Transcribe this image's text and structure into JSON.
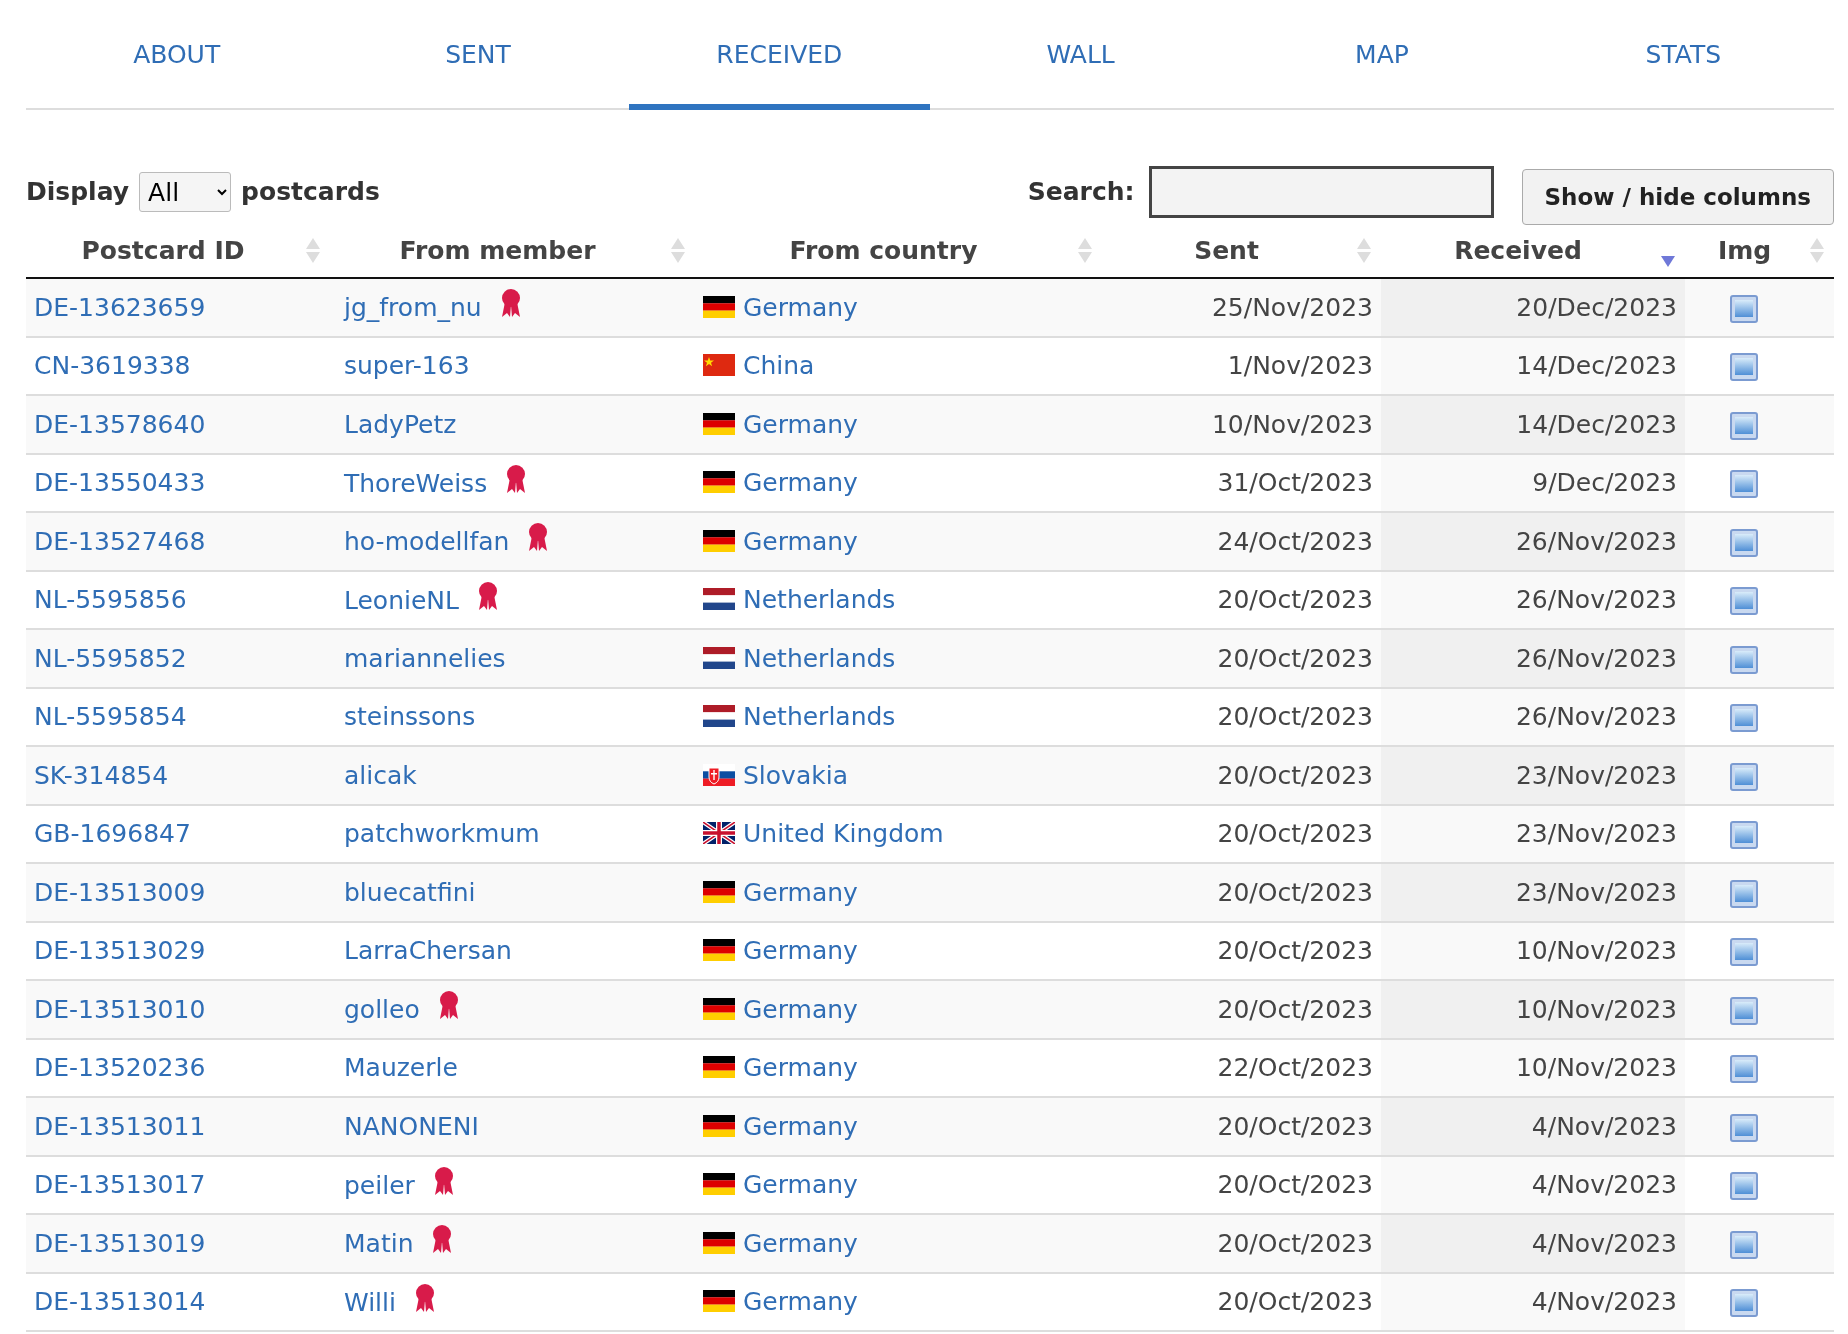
{
  "tabs": [
    {
      "label": "ABOUT",
      "selected": false
    },
    {
      "label": "SENT",
      "selected": false
    },
    {
      "label": "RECEIVED",
      "selected": true
    },
    {
      "label": "WALL",
      "selected": false
    },
    {
      "label": "MAP",
      "selected": false
    },
    {
      "label": "STATS",
      "selected": false
    }
  ],
  "display": {
    "label": "Display",
    "value": "All",
    "suffix": "postcards"
  },
  "search": {
    "label": "Search:"
  },
  "columns_button": "Show / hide columns",
  "columns": [
    {
      "label": "Postcard ID",
      "sorted": false
    },
    {
      "label": "From member",
      "sorted": false
    },
    {
      "label": "From country",
      "sorted": false
    },
    {
      "label": "Sent",
      "sorted": false
    },
    {
      "label": "Received",
      "sorted": true
    },
    {
      "label": "Img",
      "sorted": false
    }
  ],
  "rows": [
    {
      "id": "DE-13623659",
      "member": "jg_from_nu",
      "award": true,
      "kind": "de",
      "country": "Germany",
      "sent": "25/Nov/2023",
      "received": "20/Dec/2023"
    },
    {
      "id": "CN-3619338",
      "member": "super-163",
      "award": false,
      "kind": "cn",
      "country": "China",
      "sent": "1/Nov/2023",
      "received": "14/Dec/2023"
    },
    {
      "id": "DE-13578640",
      "member": "LadyPetz",
      "award": false,
      "kind": "de",
      "country": "Germany",
      "sent": "10/Nov/2023",
      "received": "14/Dec/2023"
    },
    {
      "id": "DE-13550433",
      "member": "ThoreWeiss",
      "award": true,
      "kind": "de",
      "country": "Germany",
      "sent": "31/Oct/2023",
      "received": "9/Dec/2023"
    },
    {
      "id": "DE-13527468",
      "member": "ho-modellfan",
      "award": true,
      "kind": "de",
      "country": "Germany",
      "sent": "24/Oct/2023",
      "received": "26/Nov/2023"
    },
    {
      "id": "NL-5595856",
      "member": "LeonieNL",
      "award": true,
      "kind": "nl",
      "country": "Netherlands",
      "sent": "20/Oct/2023",
      "received": "26/Nov/2023"
    },
    {
      "id": "NL-5595852",
      "member": "mariannelies",
      "award": false,
      "kind": "nl",
      "country": "Netherlands",
      "sent": "20/Oct/2023",
      "received": "26/Nov/2023"
    },
    {
      "id": "NL-5595854",
      "member": "steinssons",
      "award": false,
      "kind": "nl",
      "country": "Netherlands",
      "sent": "20/Oct/2023",
      "received": "26/Nov/2023"
    },
    {
      "id": "SK-314854",
      "member": "alicak",
      "award": false,
      "kind": "sk",
      "country": "Slovakia",
      "sent": "20/Oct/2023",
      "received": "23/Nov/2023"
    },
    {
      "id": "GB-1696847",
      "member": "patchworkmum",
      "award": false,
      "kind": "gb",
      "country": "United Kingdom",
      "sent": "20/Oct/2023",
      "received": "23/Nov/2023"
    },
    {
      "id": "DE-13513009",
      "member": "bluecatfini",
      "award": false,
      "kind": "de",
      "country": "Germany",
      "sent": "20/Oct/2023",
      "received": "23/Nov/2023"
    },
    {
      "id": "DE-13513029",
      "member": "LarraChersan",
      "award": false,
      "kind": "de",
      "country": "Germany",
      "sent": "20/Oct/2023",
      "received": "10/Nov/2023"
    },
    {
      "id": "DE-13513010",
      "member": "golleo",
      "award": true,
      "kind": "de",
      "country": "Germany",
      "sent": "20/Oct/2023",
      "received": "10/Nov/2023"
    },
    {
      "id": "DE-13520236",
      "member": "Mauzerle",
      "award": false,
      "kind": "de",
      "country": "Germany",
      "sent": "22/Oct/2023",
      "received": "10/Nov/2023"
    },
    {
      "id": "DE-13513011",
      "member": "NANONENI",
      "award": false,
      "kind": "de",
      "country": "Germany",
      "sent": "20/Oct/2023",
      "received": "4/Nov/2023"
    },
    {
      "id": "DE-13513017",
      "member": "peiler",
      "award": true,
      "kind": "de",
      "country": "Germany",
      "sent": "20/Oct/2023",
      "received": "4/Nov/2023"
    },
    {
      "id": "DE-13513019",
      "member": "Matin",
      "award": true,
      "kind": "de",
      "country": "Germany",
      "sent": "20/Oct/2023",
      "received": "4/Nov/2023"
    },
    {
      "id": "DE-13513014",
      "member": "Willi",
      "award": true,
      "kind": "de",
      "country": "Germany",
      "sent": "20/Oct/2023",
      "received": "4/Nov/2023"
    }
  ]
}
